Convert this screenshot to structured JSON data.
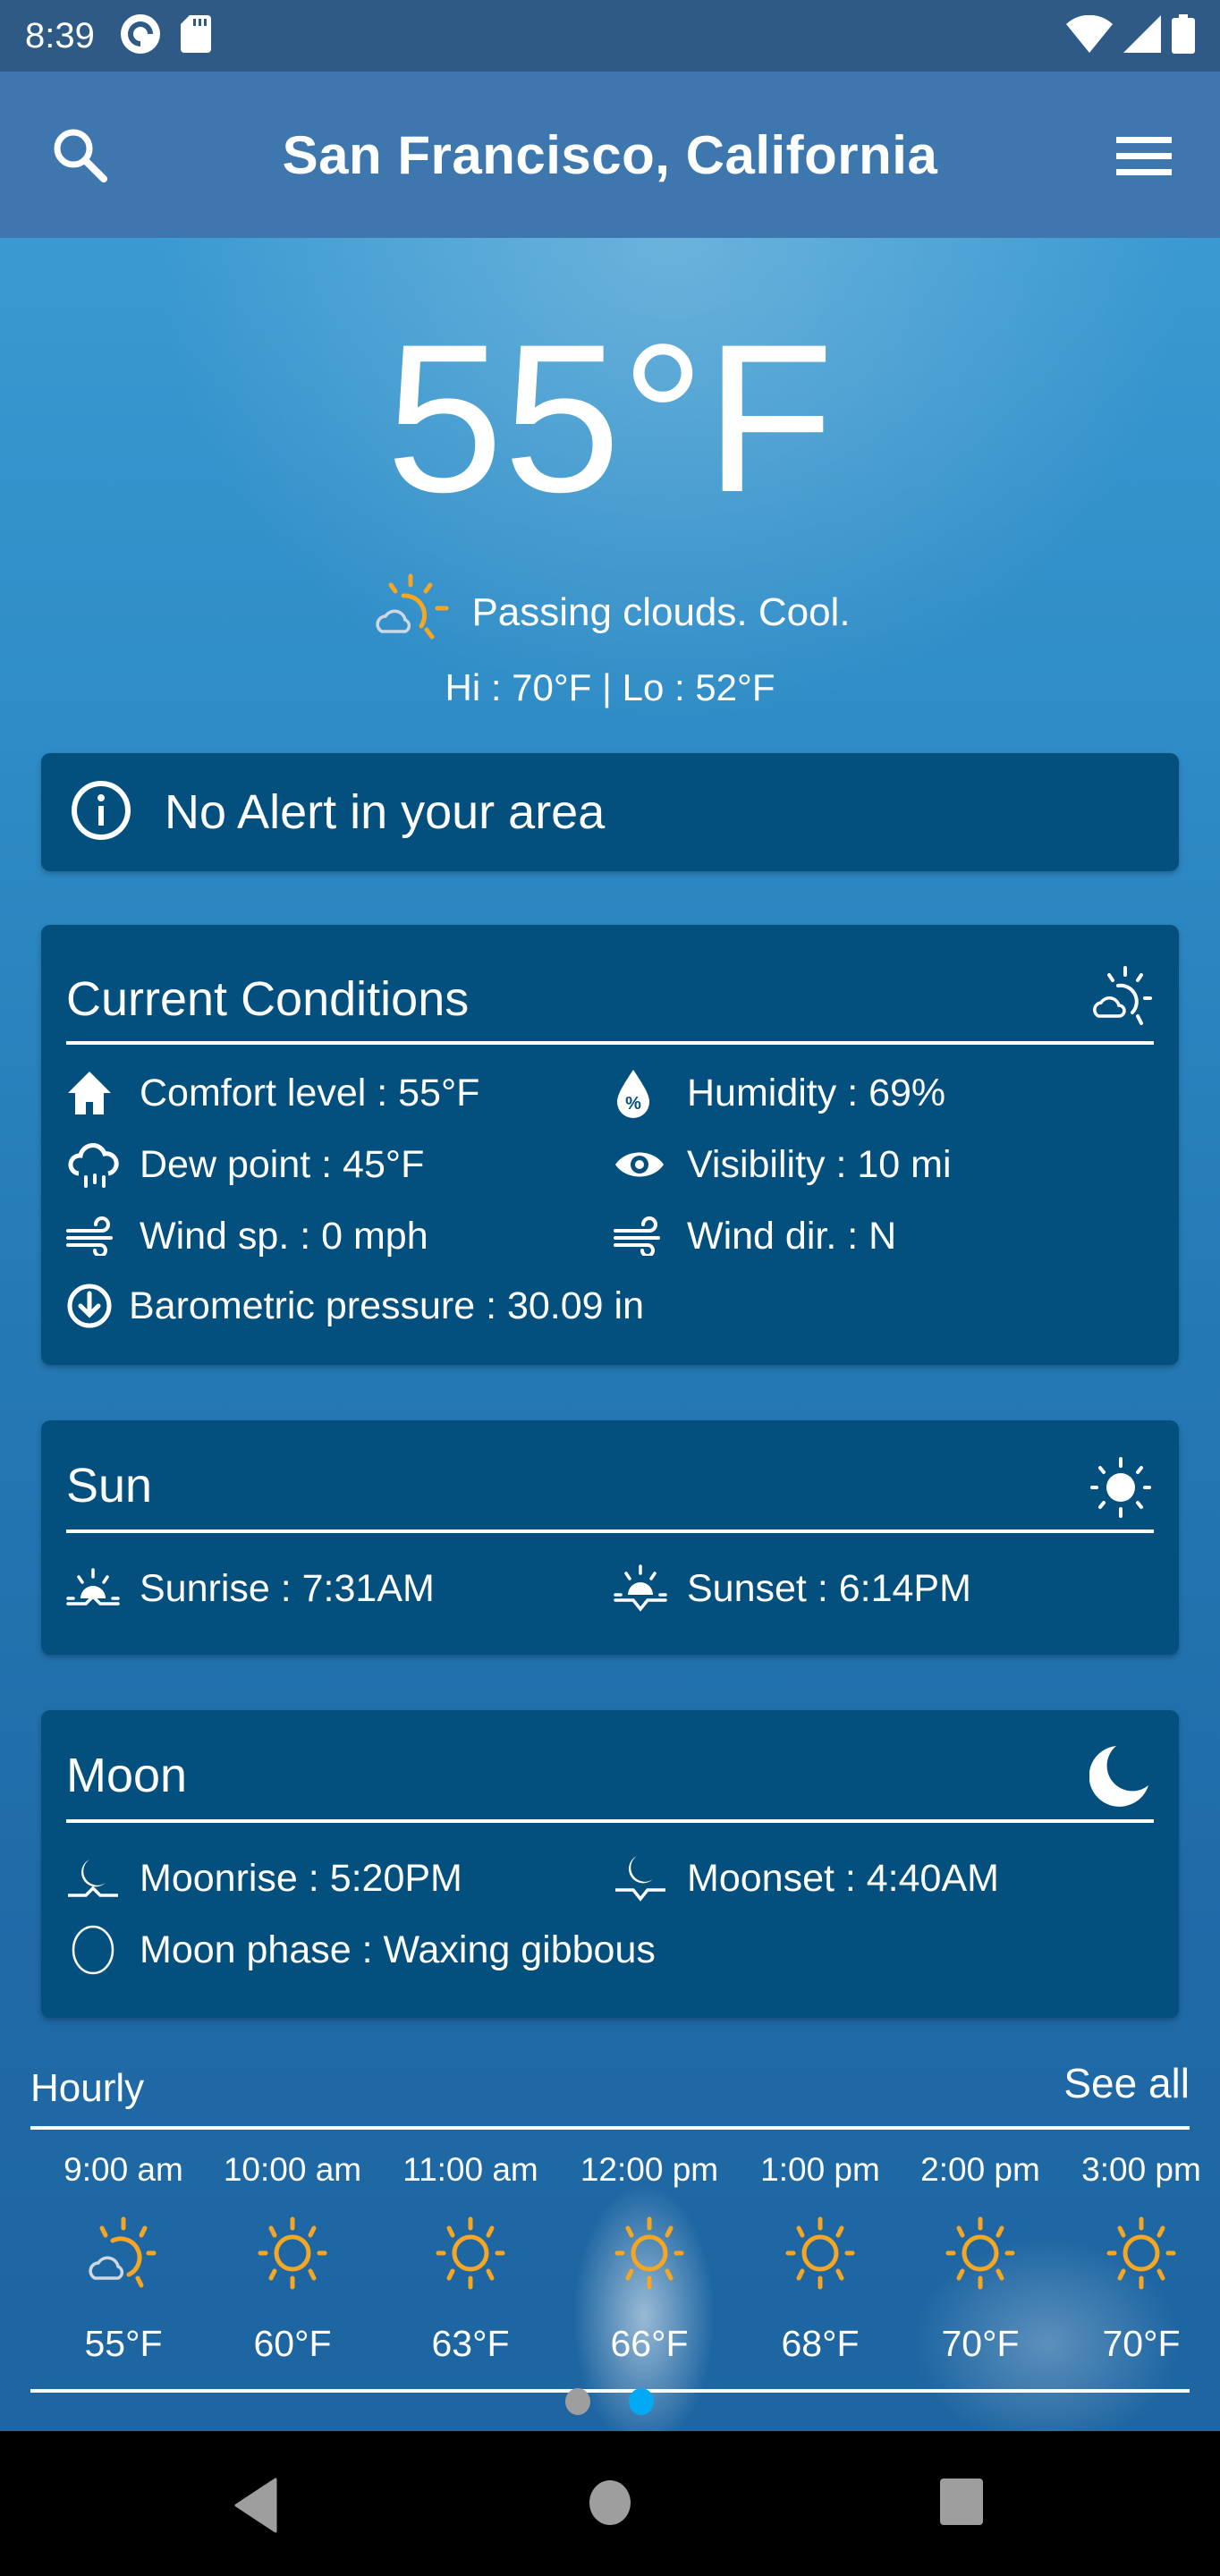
{
  "status_bar": {
    "time": "8:39",
    "left_icons": [
      "pocket-casts-icon",
      "sd-card-icon"
    ],
    "right_icons": [
      "wifi-icon",
      "cell-signal-icon",
      "battery-icon"
    ]
  },
  "app_bar": {
    "title": "San Francisco, California",
    "search_icon": "search-icon",
    "menu_icon": "menu-icon"
  },
  "current": {
    "temperature": "55°F",
    "condition": "Passing clouds. Cool.",
    "condition_icon": "partly-cloudy-icon",
    "hi_lo": "Hi : 70°F | Lo : 52°F"
  },
  "alert": {
    "icon": "info-icon",
    "text": "No Alert in your area"
  },
  "current_conditions": {
    "title": "Current Conditions",
    "items": [
      {
        "icon": "home-icon",
        "text": "Comfort level : 55°F"
      },
      {
        "icon": "humidity-drop-icon",
        "text": "Humidity : 69%"
      },
      {
        "icon": "dew-cloud-icon",
        "text": "Dew point : 45°F"
      },
      {
        "icon": "eye-icon",
        "text": "Visibility : 10 mi"
      },
      {
        "icon": "wind-icon",
        "text": "Wind sp. : 0 mph"
      },
      {
        "icon": "wind-icon",
        "text": "Wind dir. : N"
      },
      {
        "icon": "pressure-down-icon",
        "text": "Barometric pressure : 30.09 in"
      }
    ]
  },
  "sun": {
    "title": "Sun",
    "sunrise": "Sunrise : 7:31AM",
    "sunset": "Sunset : 6:14PM"
  },
  "moon": {
    "title": "Moon",
    "moonrise": "Moonrise : 5:20PM",
    "moonset": "Moonset : 4:40AM",
    "phase": "Moon phase : Waxing gibbous"
  },
  "hourly": {
    "title": "Hourly",
    "see_all": "See all",
    "hours": [
      {
        "time": "9:00 am",
        "icon": "partly-cloudy-icon",
        "temp": "55°F"
      },
      {
        "time": "10:00 am",
        "icon": "sunny-icon",
        "temp": "60°F"
      },
      {
        "time": "11:00 am",
        "icon": "sunny-icon",
        "temp": "63°F"
      },
      {
        "time": "12:00 pm",
        "icon": "sunny-icon",
        "temp": "66°F"
      },
      {
        "time": "1:00 pm",
        "icon": "sunny-icon",
        "temp": "68°F"
      },
      {
        "time": "2:00 pm",
        "icon": "sunny-icon",
        "temp": "70°F"
      },
      {
        "time": "3:00 pm",
        "icon": "sunny-icon",
        "temp": "70°F"
      }
    ],
    "pager": {
      "pages": 2,
      "active_index": 1,
      "active_color": "#03a9f4",
      "inactive_color": "#9e9e9e"
    }
  },
  "colors": {
    "card_bg": "#034f7e",
    "app_bar": "#3d77ae",
    "status_bar": "#2e5a85",
    "sun_orange": "#f5a623"
  }
}
